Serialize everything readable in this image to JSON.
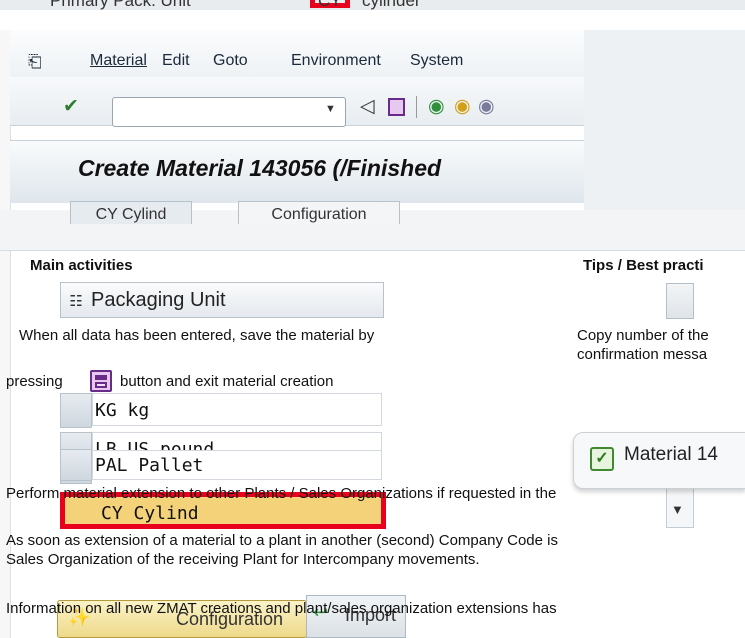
{
  "background_screen": {
    "top_field_label": "Primary Pack. Unit",
    "top_field_value": "CY",
    "top_field_desc": "cylinder"
  },
  "menu": {
    "items": [
      "Material",
      "Edit",
      "Goto",
      "Environment",
      "System"
    ]
  },
  "title": "Create Material 143056 (/Finished",
  "tabs": [
    "CY Cylind",
    "Configuration"
  ],
  "sections": {
    "main_heading": "Main activities",
    "tips_heading": "Tips / Best practi"
  },
  "packaging_list": {
    "header": "Packaging Unit",
    "rows": [
      "KG  kg",
      "LB US pound",
      "PAL Pallet",
      "CY Cylind"
    ]
  },
  "instructions": {
    "save_line1": "When all data has been entered, save the material by",
    "save_line2_pre": "pressing",
    "save_line2_post": "button and exit material creation",
    "tips_line1": "Copy number of the",
    "tips_line2": "confirmation messa",
    "extension_line": "Perform material extension to other Plants / Sales Organizations if requested in the",
    "intercompany_line1": "As soon as extension of a material to a plant in another (second) Company Code is",
    "intercompany_line2": "Sales Organization of the receiving Plant for Intercompany movements.",
    "info_line": "Information on all new ZMAT creations and plant/sales organization extensions has"
  },
  "message": {
    "text": "Material 14"
  },
  "buttons": {
    "configuration": "Configuration",
    "import": "Import"
  },
  "colors": {
    "highlight_red": "#e8001c",
    "selected_row": "#f4d27a",
    "config_button": "#eed98a"
  },
  "icons": {
    "confirm": "check-circle-icon",
    "back": "triangle-left-icon",
    "save": "save-icon",
    "nav_back": "green-arrow-icon",
    "exit": "exit-icon",
    "cancel": "cancel-icon"
  }
}
